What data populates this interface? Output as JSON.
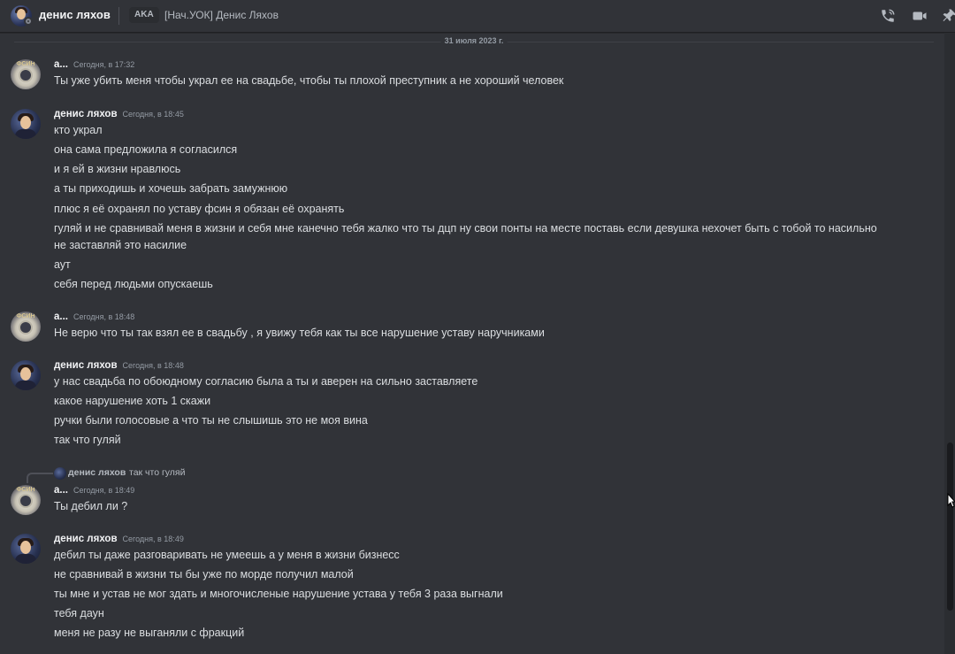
{
  "header": {
    "name": "денис ляхов",
    "aka_label": "AKA",
    "aka_names": "[Нач.УОК] Денис Ляхов",
    "icons": [
      "phone-call-icon",
      "video-call-icon",
      "pin-icon"
    ]
  },
  "chat": {
    "date_divider": "31 июля 2023 г.",
    "reply_preview": {
      "author": "денис ляхов",
      "text": "так что гуляй"
    },
    "messages": [
      {
        "author": "а...",
        "timestamp": "Сегодня, в 17:32",
        "lines": [
          "Ты  уже убить меня чтобы украл ее на свадьбе, чтобы ты плохой  преступник а не хороший человек"
        ]
      },
      {
        "author": "денис ляхов",
        "timestamp": "Сегодня, в 18:45",
        "lines": [
          "кто украл",
          "она сама предложила я согласился",
          "и я ей в жизни нравлюсь",
          "а ты приходишь и хочешь забрать замужнюю",
          "плюс я её охранял по уставу фсин я обязан её охранять",
          "гуляй и не сравнивай меня в жизни и себя мне канечно тебя жалко что ты дцп ну свои понты на месте поставь если девушка нехочет быть с тобой то насильно",
          "не заставляй это насилие",
          "аут",
          "себя перед людьми опускаешь"
        ]
      },
      {
        "author": "а...",
        "timestamp": "Сегодня, в 18:48",
        "lines": [
          "Не верю что ты так  взял ее в свадьбу ,  я увижу тебя как ты все  нарушение уставу наручниками"
        ]
      },
      {
        "author": "денис ляхов",
        "timestamp": "Сегодня, в 18:48",
        "lines": [
          "у нас свадьба по обоюдному согласию была а ты и аверен на сильно заставляете",
          "какое нарушение хоть 1 скажи",
          "ручки были голосовые а что ты не слышишь это не моя вина",
          "так что гуляй"
        ]
      },
      {
        "author": "а...",
        "timestamp": "Сегодня, в 18:49",
        "lines": [
          "Ты дебил ли ?"
        ]
      },
      {
        "author": "денис ляхов",
        "timestamp": "Сегодня, в 18:49",
        "lines": [
          "дебил ты даже разговаривать не умеешь а у меня в жизни бизнесс",
          "не сравнивай в жизни ты бы уже по морде получил малой",
          "ты мне и устав не мог здать и многочисленые нарушение устава у тебя 3 раза выгнали",
          "тебя даун",
          "меня не разу не выганяли с фракций"
        ]
      }
    ]
  },
  "colors": {
    "background": "#313338",
    "text": "#dbdee1",
    "muted": "#949ba4"
  }
}
